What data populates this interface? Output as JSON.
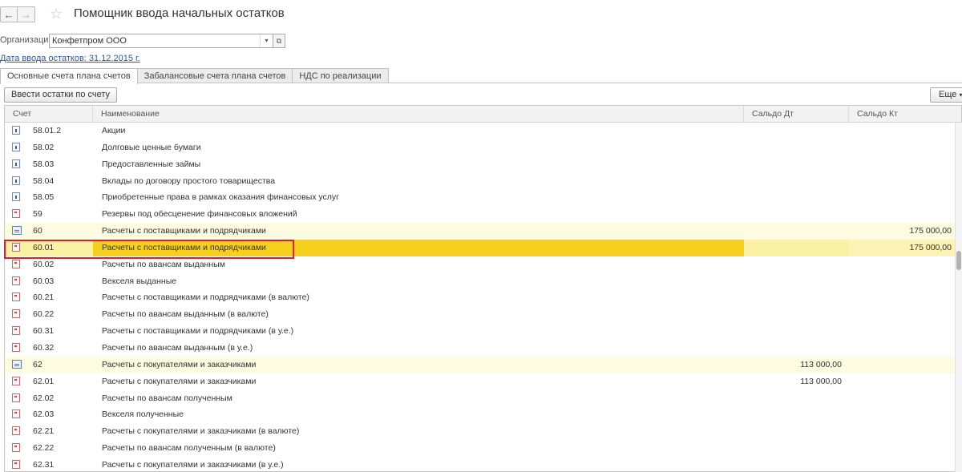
{
  "window": {
    "title": "Помощник ввода начальных остатков",
    "back_icon": "←",
    "forward_icon": "→",
    "star_icon": "☆"
  },
  "organization": {
    "label": "Организация:",
    "value": "Конфетпром ООО",
    "dropdown_icon": "▾",
    "open_icon": "⧉"
  },
  "date_link": "Дата ввода остатков: 31.12.2015 г.",
  "tabs": [
    {
      "label": "Основные счета плана счетов",
      "active": true
    },
    {
      "label": "Забалансовые счета плана счетов",
      "active": false
    },
    {
      "label": "НДС по реализации",
      "active": false
    }
  ],
  "toolbar": {
    "enter_button": "Ввести остатки по счету",
    "more_button": "Еще",
    "more_icon": "▾"
  },
  "table": {
    "headers": {
      "account": "Счет",
      "name": "Наименование",
      "debit": "Сальдо Дт",
      "credit": "Сальдо Кт"
    },
    "rows": [
      {
        "icon": "account-icon",
        "account": "58.01.2",
        "name": "Акции",
        "debit": "",
        "credit": ""
      },
      {
        "icon": "account-icon",
        "account": "58.02",
        "name": "Долговые ценные бумаги",
        "debit": "",
        "credit": ""
      },
      {
        "icon": "account-icon",
        "account": "58.03",
        "name": "Предоставленные займы",
        "debit": "",
        "credit": ""
      },
      {
        "icon": "account-icon",
        "account": "58.04",
        "name": "Вклады по договору простого товарищества",
        "debit": "",
        "credit": ""
      },
      {
        "icon": "account-icon",
        "account": "58.05",
        "name": "Приобретенные права в рамках оказания финансовых услуг",
        "debit": "",
        "credit": ""
      },
      {
        "icon": "account-red-icon",
        "account": "59",
        "name": "Резервы под обесценение финансовых вложений",
        "debit": "",
        "credit": ""
      },
      {
        "icon": "account-group-icon",
        "account": "60",
        "name": "Расчеты с поставщиками и подрядчиками",
        "debit": "",
        "credit": "175 000,00",
        "style": "yellow"
      },
      {
        "icon": "account-red-icon",
        "account": "60.01",
        "name": "Расчеты с поставщиками и подрядчиками",
        "debit": "",
        "credit": "175 000,00",
        "style": "selected"
      },
      {
        "icon": "account-red-icon",
        "account": "60.02",
        "name": "Расчеты по авансам выданным",
        "debit": "",
        "credit": ""
      },
      {
        "icon": "account-red-icon",
        "account": "60.03",
        "name": "Векселя выданные",
        "debit": "",
        "credit": ""
      },
      {
        "icon": "account-red-icon",
        "account": "60.21",
        "name": "Расчеты с поставщиками и подрядчиками (в валюте)",
        "debit": "",
        "credit": ""
      },
      {
        "icon": "account-red-icon",
        "account": "60.22",
        "name": "Расчеты по авансам выданным (в валюте)",
        "debit": "",
        "credit": ""
      },
      {
        "icon": "account-red-icon",
        "account": "60.31",
        "name": "Расчеты с поставщиками и подрядчиками (в у.е.)",
        "debit": "",
        "credit": ""
      },
      {
        "icon": "account-red-icon",
        "account": "60.32",
        "name": "Расчеты по авансам выданным (в у.е.)",
        "debit": "",
        "credit": ""
      },
      {
        "icon": "account-group-icon",
        "account": "62",
        "name": "Расчеты с покупателями и заказчиками",
        "debit": "113 000,00",
        "credit": "",
        "style": "yellow"
      },
      {
        "icon": "account-red-icon",
        "account": "62.01",
        "name": "Расчеты с покупателями и заказчиками",
        "debit": "113 000,00",
        "credit": ""
      },
      {
        "icon": "account-red-icon",
        "account": "62.02",
        "name": "Расчеты по авансам полученным",
        "debit": "",
        "credit": ""
      },
      {
        "icon": "account-red-icon",
        "account": "62.03",
        "name": "Векселя полученные",
        "debit": "",
        "credit": ""
      },
      {
        "icon": "account-red-icon",
        "account": "62.21",
        "name": "Расчеты с покупателями и заказчиками (в валюте)",
        "debit": "",
        "credit": ""
      },
      {
        "icon": "account-red-icon",
        "account": "62.22",
        "name": "Расчеты по авансам полученным (в валюте)",
        "debit": "",
        "credit": ""
      },
      {
        "icon": "account-red-icon",
        "account": "62.31",
        "name": "Расчеты с покупателями и заказчиками (в у.е.)",
        "debit": "",
        "credit": ""
      }
    ]
  },
  "colors": {
    "selected_name_bg": "#f7cf1d",
    "selected_row_bg": "#fbf1a5",
    "group_row_bg": "#fdfbe0",
    "highlight_border": "#e02020",
    "link": "#2a5aa6"
  }
}
